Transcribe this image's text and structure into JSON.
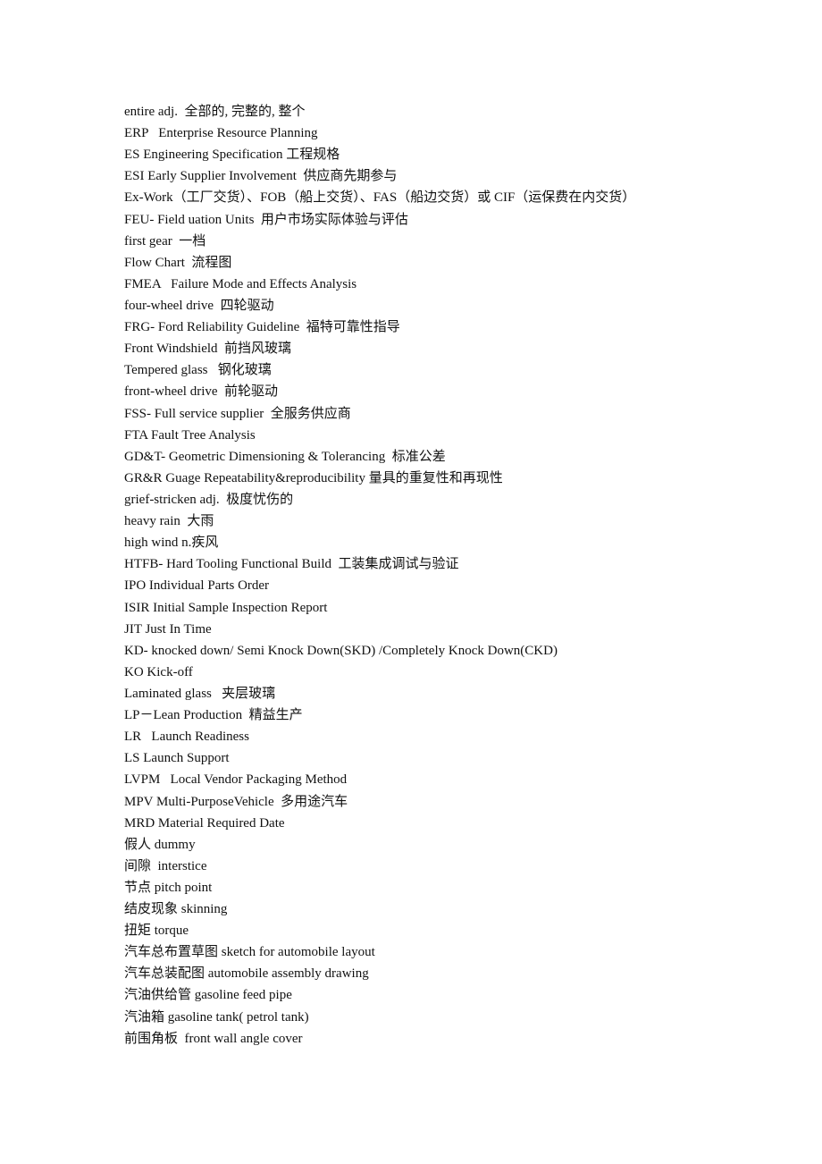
{
  "document": {
    "lines": [
      "entire adj.  全部的, 完整的, 整个",
      "ERP   Enterprise Resource Planning",
      "ES Engineering Specification 工程规格",
      "ESI Early Supplier Involvement  供应商先期参与",
      "Ex-Work（工厂交货）、FOB（船上交货）、FAS（船边交货）或 CIF（运保费在内交货）",
      "FEU- Field uation Units  用户市场实际体验与评估",
      "first gear  一档",
      "Flow Chart  流程图",
      "FMEA   Failure Mode and Effects Analysis",
      "four-wheel drive  四轮驱动",
      "FRG- Ford Reliability Guideline  福特可靠性指导",
      "Front Windshield  前挡风玻璃",
      "Tempered glass   钢化玻璃",
      "front-wheel drive  前轮驱动",
      "FSS- Full service supplier  全服务供应商",
      "FTA Fault Tree Analysis",
      "GD&T- Geometric Dimensioning & Tolerancing  标准公差",
      "GR&R Guage Repeatability&reproducibility 量具的重复性和再现性",
      "grief-stricken adj.  极度忧伤的",
      "heavy rain  大雨",
      "high wind n.疾风",
      "HTFB- Hard Tooling Functional Build  工装集成调试与验证",
      "IPO Individual Parts Order",
      "ISIR Initial Sample Inspection Report",
      "JIT Just In Time",
      "KD- knocked down/ Semi Knock Down(SKD) /Completely Knock Down(CKD)",
      "KO Kick-off",
      "Laminated glass   夹层玻璃",
      "LP－Lean Production  精益生产",
      "LR   Launch Readiness",
      "LS Launch Support",
      "LVPM   Local Vendor Packaging Method",
      "MPV Multi-PurposeVehicle  多用途汽车",
      "MRD Material Required Date",
      "假人 dummy",
      "间隙  interstice",
      "节点 pitch point",
      "结皮现象 skinning",
      "扭矩 torque",
      "汽车总布置草图 sketch for automobile layout",
      "汽车总装配图 automobile assembly drawing",
      "汽油供给管 gasoline feed pipe",
      "汽油箱 gasoline tank( petrol tank)",
      "前围角板  front wall angle cover"
    ]
  }
}
